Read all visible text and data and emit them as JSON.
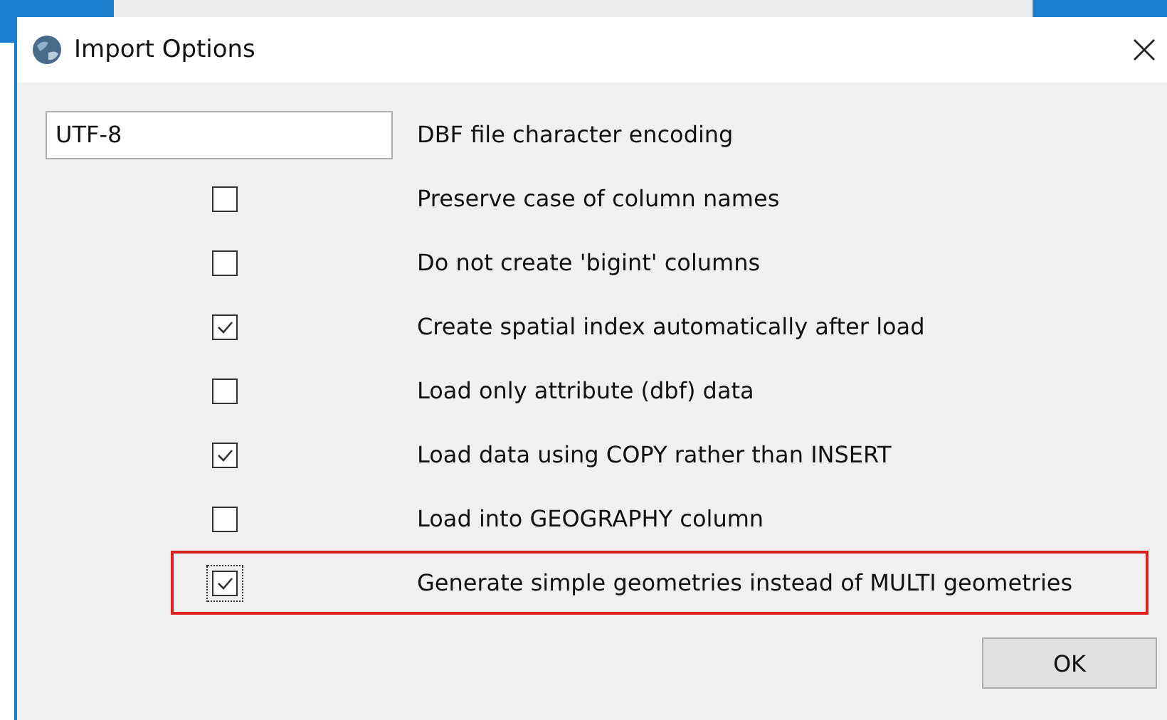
{
  "window": {
    "title": "Import Options"
  },
  "encoding": {
    "value": "UTF-8",
    "label": "DBF file character encoding"
  },
  "options": [
    {
      "label": "Preserve case of column names",
      "checked": false,
      "focused": false,
      "highlighted": false
    },
    {
      "label": "Do not create 'bigint' columns",
      "checked": false,
      "focused": false,
      "highlighted": false
    },
    {
      "label": "Create spatial index automatically after load",
      "checked": true,
      "focused": false,
      "highlighted": false
    },
    {
      "label": "Load only attribute (dbf) data",
      "checked": false,
      "focused": false,
      "highlighted": false
    },
    {
      "label": "Load data using COPY rather than INSERT",
      "checked": true,
      "focused": false,
      "highlighted": false
    },
    {
      "label": "Load into GEOGRAPHY column",
      "checked": false,
      "focused": false,
      "highlighted": false
    },
    {
      "label": "Generate simple geometries instead of MULTI geometries",
      "checked": true,
      "focused": true,
      "highlighted": true
    }
  ],
  "buttons": [
    {
      "label": "OK"
    }
  ]
}
